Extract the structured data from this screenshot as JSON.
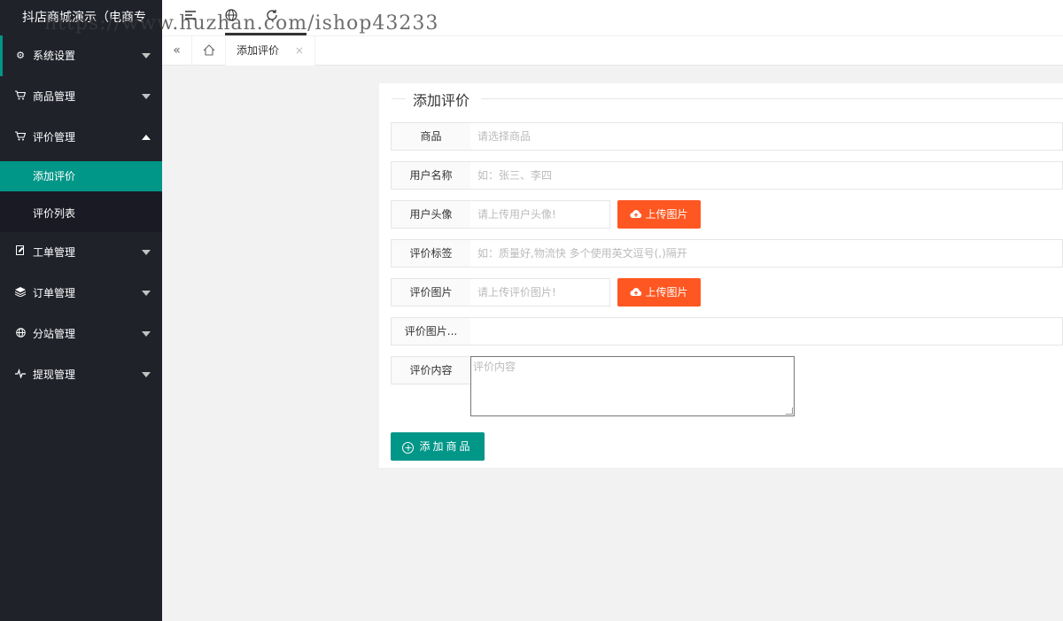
{
  "app": {
    "title": "抖店商城演示（电商专",
    "watermark": "https://www.huzhan.com/ishop43233"
  },
  "header": {
    "icons": [
      "menu-icon",
      "globe-icon",
      "refresh-icon"
    ]
  },
  "sidebar": {
    "items": [
      {
        "label": "系统设置",
        "icon": "gear-icon"
      },
      {
        "label": "商品管理",
        "icon": "cart-icon"
      },
      {
        "label": "评价管理",
        "icon": "cart-icon"
      },
      {
        "label": "工单管理",
        "icon": "edit-icon"
      },
      {
        "label": "订单管理",
        "icon": "layers-icon"
      },
      {
        "label": "分站管理",
        "icon": "globe-icon"
      },
      {
        "label": "提现管理",
        "icon": "pulse-icon"
      }
    ],
    "submenu": [
      {
        "label": "添加评价",
        "active": true
      },
      {
        "label": "评价列表",
        "active": false
      }
    ]
  },
  "tabs": {
    "active_label": "添加评价",
    "close": "×"
  },
  "form": {
    "legend": "添加评价",
    "fields": [
      {
        "label": "商品",
        "placeholder": "请选择商品"
      },
      {
        "label": "用户名称",
        "placeholder": "如：张三、李四"
      },
      {
        "label": "用户头像",
        "placeholder": "请上传用户头像!"
      },
      {
        "label": "评价标签",
        "placeholder": "如：质量好,物流快 多个使用英文逗号(,)隔开"
      },
      {
        "label": "评价图片",
        "placeholder": "请上传评价图片!"
      },
      {
        "label": "评价图片...",
        "placeholder": ""
      },
      {
        "label": "评价内容",
        "placeholder": "评价内容"
      }
    ],
    "upload_label": "上传图片",
    "submit_label": "添加商品"
  },
  "colors": {
    "sidebar_bg": "#20222a",
    "accent": "#009688",
    "upload": "#ff5722"
  }
}
